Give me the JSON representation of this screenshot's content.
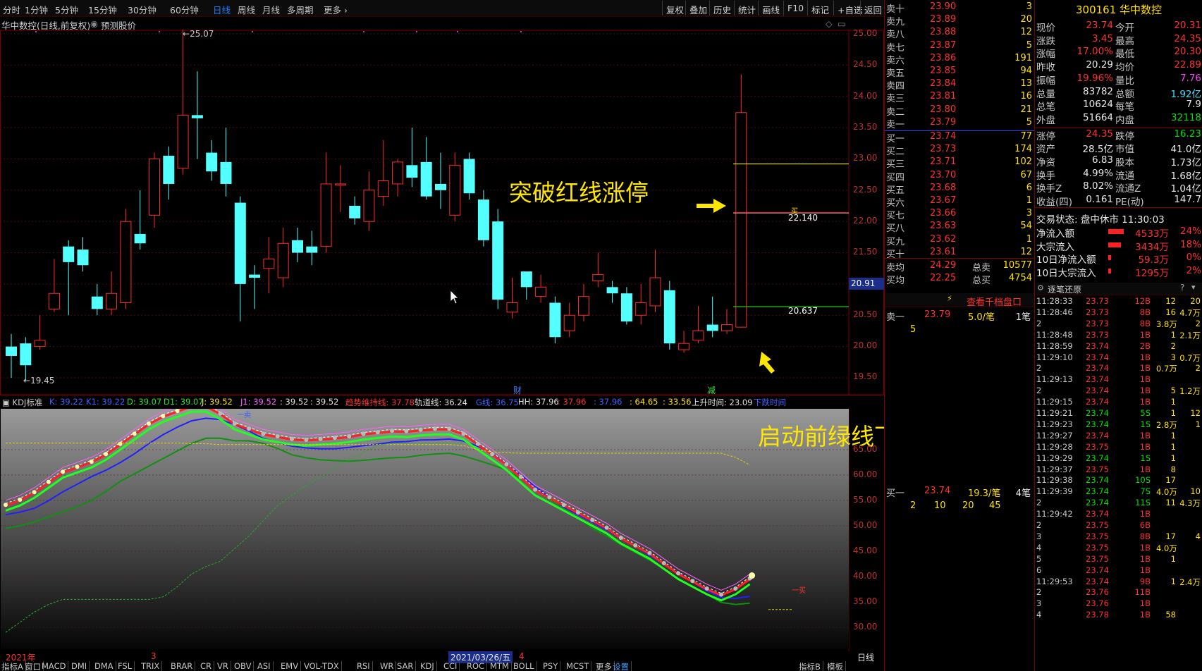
{
  "topbar": {
    "periods": [
      "分时",
      "1分钟",
      "5分钟",
      "15分钟",
      "30分钟",
      "60分钟",
      "日线",
      "周线",
      "月线",
      "多周期",
      "更多"
    ],
    "active": "日线",
    "tools": [
      "复权",
      "叠加",
      "历史",
      "统计",
      "画线",
      "F10",
      "标记",
      "+自选",
      "返回"
    ]
  },
  "title": {
    "name": "华中数控(日线,前复权)",
    "predict": "预测股价"
  },
  "price_axis": {
    "labels": [
      "25.00",
      "24.50",
      "24.00",
      "23.50",
      "23.00",
      "22.50",
      "22.00",
      "21.50",
      "21.00",
      "20.50",
      "20.00",
      "19.50"
    ],
    "current": "20.91"
  },
  "markers": {
    "high": "25.07",
    "low": "19.45",
    "upper": "22.140",
    "lower": "20.637",
    "upper_tag": "买",
    "cai": "财",
    "jian": "减"
  },
  "annotations": {
    "break": "突破红线涨停",
    "below": "启动前绿线下方"
  },
  "kdj": {
    "name": "KDJ标准",
    "items": [
      {
        "t": "K: 39.22",
        "c": "#4060ff"
      },
      {
        "t": "K1: 39.22",
        "c": "#4060ff"
      },
      {
        "t": "D: 39.07",
        "c": "#30e030"
      },
      {
        "t": "D1: 39.07",
        "c": "#30e030"
      },
      {
        "t": "J: 39.52",
        "c": "#ffe000"
      },
      {
        "t": "J1: 39.52",
        "c": "#ff60ff"
      },
      {
        "t": ": 39.52",
        "c": "#e0e0e0"
      },
      {
        "t": ": 39.52",
        "c": "#e0e0e0"
      },
      {
        "t": "趋势维持线: 37.78",
        "c": "#ff3030"
      },
      {
        "t": "轨道线: 36.24",
        "c": "#e0e0e0"
      },
      {
        "t": "G线: 36.75",
        "c": "#4060ff"
      },
      {
        "t": "HH: 37.96",
        "c": "#e0e0e0"
      },
      {
        "t": ": 37.96",
        "c": "#ff3030"
      },
      {
        "t": ": 37.96",
        "c": "#4060ff"
      },
      {
        "t": ": 64.65",
        "c": "#ffe000"
      },
      {
        "t": ": 33.56",
        "c": "#ffe000"
      },
      {
        "t": "上升时间: 23.09",
        "c": "#e0e0e0"
      },
      {
        "t": "下跌时间",
        "c": "#4060ff"
      }
    ],
    "axis": [
      "65.00",
      "60.00",
      "55.00",
      "50.00",
      "45.00",
      "40.00",
      "35.00",
      "30.00"
    ],
    "sell_tag": "一卖",
    "buy_tag": "一买"
  },
  "bottom": {
    "dates": [
      "2021年",
      "3",
      "2021/03/26/五",
      "4"
    ],
    "tabs": [
      "指标A",
      "窗口",
      "MACD",
      "DMI",
      "DMA",
      "FSL",
      "TRIX",
      "BRAR",
      "CR",
      "VR",
      "OBV",
      "ASI",
      "EMV",
      "VOL-TDX",
      "RSI",
      "WR",
      "SAR",
      "KDJ",
      "CCI",
      "ROC",
      "MTM",
      "BOLL",
      "PSY",
      "MCST",
      "更多",
      "设置"
    ],
    "right": [
      "指标B",
      "模板"
    ],
    "period_label": "日线"
  },
  "orderbook": {
    "sells": [
      [
        "卖十",
        "23.90",
        "3"
      ],
      [
        "卖九",
        "23.89",
        "20"
      ],
      [
        "卖八",
        "23.88",
        "12"
      ],
      [
        "卖七",
        "23.87",
        "5"
      ],
      [
        "卖六",
        "23.86",
        "191"
      ],
      [
        "卖五",
        "23.85",
        "94"
      ],
      [
        "卖四",
        "23.84",
        "13"
      ],
      [
        "卖三",
        "23.81",
        "16"
      ],
      [
        "卖二",
        "23.80",
        "21"
      ],
      [
        "卖一",
        "23.79",
        "5"
      ]
    ],
    "buys": [
      [
        "买一",
        "23.74",
        "77"
      ],
      [
        "买二",
        "23.73",
        "174"
      ],
      [
        "买三",
        "23.71",
        "102"
      ],
      [
        "买四",
        "23.70",
        "67"
      ],
      [
        "买五",
        "23.68",
        "6"
      ],
      [
        "买六",
        "23.67",
        "1"
      ],
      [
        "买七",
        "23.66",
        "3"
      ],
      [
        "买八",
        "23.63",
        "54"
      ],
      [
        "买九",
        "23.62",
        "1"
      ],
      [
        "买十",
        "23.61",
        "12"
      ]
    ],
    "avg_sell": [
      "卖均",
      "24.29",
      "总卖",
      "10577"
    ],
    "avg_buy": [
      "买均",
      "22.25",
      "总买",
      "4754"
    ],
    "detail_link": "查看千档盘口",
    "sell1_detail": [
      "卖一",
      "23.79",
      "5.0/笔",
      "1笔"
    ],
    "sell1_qty": "5",
    "buy1_detail": [
      "买一",
      "23.74",
      "19.3/笔",
      "4笔"
    ],
    "buy1_qty": [
      "2",
      "10",
      "20",
      "45"
    ]
  },
  "stock": {
    "code_name": "300161 华中数控",
    "rows": [
      [
        "现价",
        "23.74",
        "今开",
        "20.31"
      ],
      [
        "涨跌",
        "3.45",
        "最高",
        "24.35"
      ],
      [
        "涨幅",
        "17.00%",
        "最低",
        "20.30"
      ],
      [
        "昨收",
        "20.29",
        "均价",
        "22.89"
      ],
      [
        "振幅",
        "19.96%",
        "量比",
        "7.76"
      ],
      [
        "总量",
        "83782",
        "总额",
        "1.92亿"
      ],
      [
        "总笔",
        "10624",
        "每笔",
        "7.9"
      ],
      [
        "外盘",
        "51664",
        "内盘",
        "32118"
      ],
      [
        "涨停",
        "24.35",
        "跌停",
        "16.23"
      ],
      [
        "资产",
        "28.5亿",
        "市值",
        "41.0亿"
      ],
      [
        "净资",
        "6.83",
        "股本",
        "1.73亿"
      ],
      [
        "换手",
        "4.99%",
        "流通",
        "1.68亿"
      ],
      [
        "换手Z",
        "8.02%",
        "流通Z",
        "1.04亿"
      ],
      [
        "收益(四)",
        "0.161",
        "PE(动)",
        "147.7"
      ]
    ],
    "status": "交易状态: 盘中休市 11:30:03",
    "flows": [
      [
        "净流入额",
        "4533万",
        "24%"
      ],
      [
        "大宗流入",
        "3434万",
        "18%"
      ],
      [
        "10日净流入额",
        "59.3万",
        "0%"
      ],
      [
        "10日大宗流入",
        "1295万",
        "2%"
      ]
    ]
  },
  "ticks": {
    "title": "逐笔还原",
    "rows": [
      [
        "11:28:33",
        "23.73",
        "12B",
        "12",
        "20"
      ],
      [
        "11:28:46",
        "23.73",
        "8B",
        "16",
        "4.7万"
      ],
      [
        "2",
        "23.73",
        "8B",
        "3.8万",
        "2"
      ],
      [
        "11:28:48",
        "23.73",
        "1B",
        "1",
        "2.1万"
      ],
      [
        "11:28:59",
        "23.74",
        "2B",
        "2",
        ""
      ],
      [
        "11:29:10",
        "23.74",
        "1B",
        "3",
        "0.7万"
      ],
      [
        "2",
        "23.74",
        "1B",
        "0.7万",
        "2"
      ],
      [
        "11:29:13",
        "23.74",
        "1B",
        "",
        ""
      ],
      [
        "2",
        "23.74",
        "1B",
        "5",
        "1.2万"
      ],
      [
        "11:29:15",
        "23.74",
        "1B",
        "1",
        ""
      ],
      [
        "11:29:21",
        "23.74",
        "5S",
        "1",
        "12"
      ],
      [
        "11:29:23",
        "23.74",
        "1S",
        "2.8万",
        "1"
      ],
      [
        "11:29:27",
        "23.74",
        "1B",
        "1",
        ""
      ],
      [
        "11:29:28",
        "23.75",
        "1B",
        "1",
        ""
      ],
      [
        "11:29:29",
        "23.74",
        "1S",
        "1",
        ""
      ],
      [
        "11:29:37",
        "23.75",
        "1B",
        "8",
        ""
      ],
      [
        "11:29:38",
        "23.74",
        "10S",
        "17",
        ""
      ],
      [
        "11:29:39",
        "23.74",
        "7S",
        "4.0万",
        "10"
      ],
      [
        "2",
        "23.74",
        "11S",
        "11",
        "4.3万"
      ],
      [
        "11:29:42",
        "23.74",
        "1B",
        "",
        ""
      ],
      [
        "2",
        "23.75",
        "6B",
        "",
        ""
      ],
      [
        "3",
        "23.75",
        "8B",
        "17",
        "4"
      ],
      [
        "4",
        "23.75",
        "1B",
        "4.0万",
        ""
      ],
      [
        "5",
        "23.75",
        "1B",
        "1",
        ""
      ],
      [
        "6",
        "23.74",
        "1B",
        "",
        ""
      ],
      [
        "11:29:53",
        "23.74",
        "9B",
        "1",
        "2.4万"
      ],
      [
        "2",
        "23.76",
        "11B",
        "",
        ""
      ],
      [
        "3",
        "23.76",
        "1B",
        "",
        ""
      ],
      [
        "4",
        "23.78",
        "1B",
        "58",
        ""
      ]
    ]
  }
}
